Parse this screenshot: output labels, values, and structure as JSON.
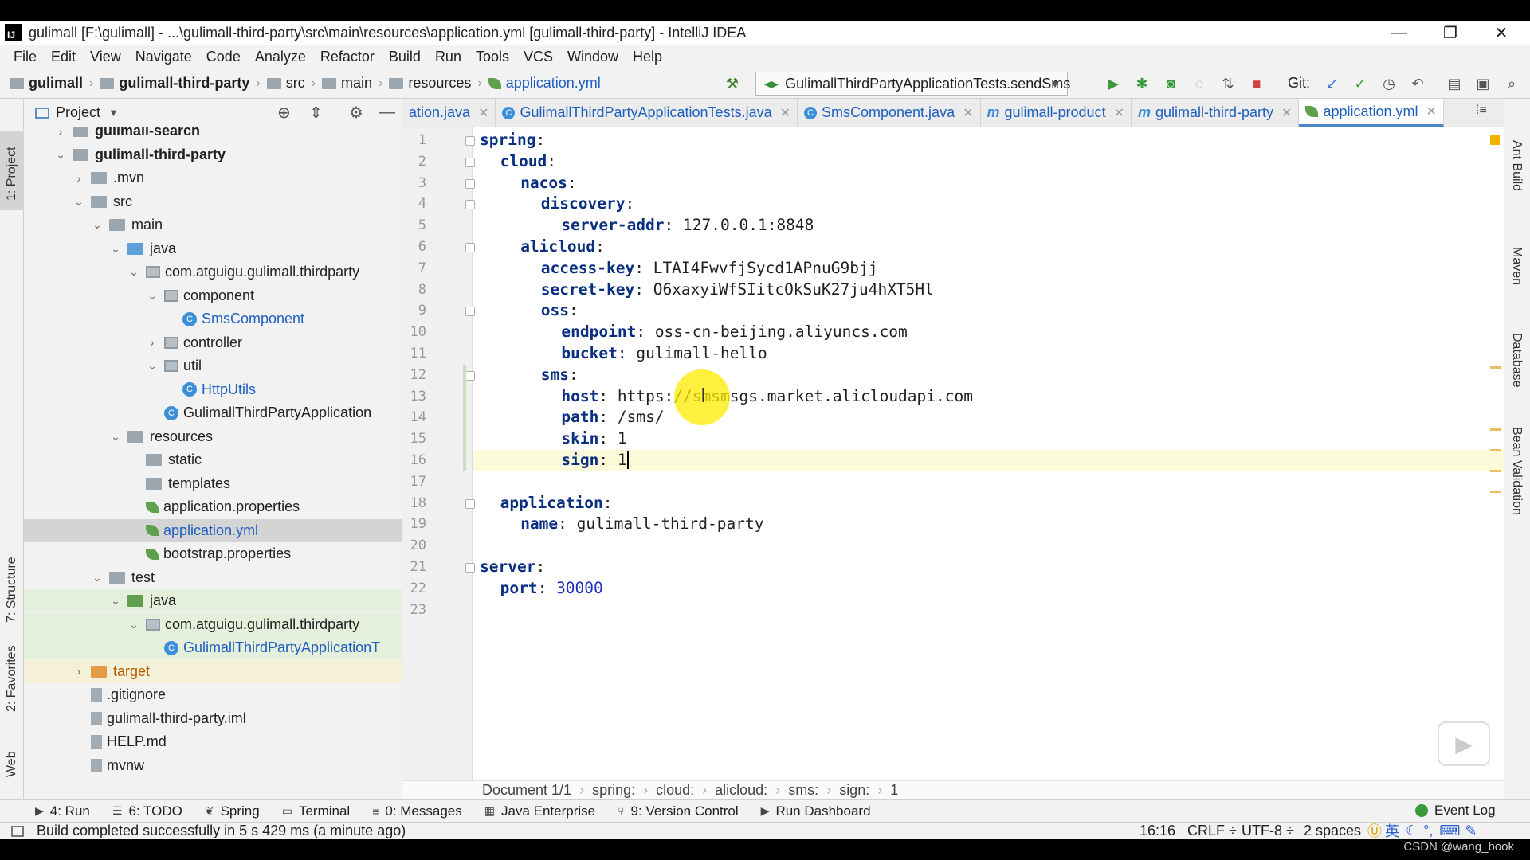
{
  "window": {
    "title": "gulimall [F:\\gulimall] - ...\\gulimall-third-party\\src\\main\\resources\\application.yml [gulimall-third-party] - IntelliJ IDEA",
    "logo_text": "IJ"
  },
  "menu": [
    "File",
    "Edit",
    "View",
    "Navigate",
    "Code",
    "Analyze",
    "Refactor",
    "Build",
    "Run",
    "Tools",
    "VCS",
    "Window",
    "Help"
  ],
  "nav": {
    "crumbs": [
      "gulimall",
      "gulimall-third-party",
      "src",
      "main",
      "resources",
      "application.yml"
    ],
    "run_config": "GulimallThirdPartyApplicationTests.sendSms",
    "git_label": "Git:"
  },
  "tabs": [
    {
      "label": "ation.java",
      "icon": "java-class-icon"
    },
    {
      "label": "GulimallThirdPartyApplicationTests.java",
      "icon": "java-class-icon"
    },
    {
      "label": "SmsComponent.java",
      "icon": "java-class-icon"
    },
    {
      "label": "gulimall-product",
      "icon": "maven-icon"
    },
    {
      "label": "gulimall-third-party",
      "icon": "maven-icon"
    },
    {
      "label": "application.yml",
      "icon": "yaml-icon",
      "active": true
    }
  ],
  "project_panel": {
    "title": "Project",
    "tree": [
      {
        "label": "gulimall-search",
        "depth": 1,
        "arrow": "right",
        "icon": "module",
        "bold": true
      },
      {
        "label": "gulimall-third-party",
        "depth": 1,
        "arrow": "down",
        "icon": "module",
        "bold": true
      },
      {
        "label": ".mvn",
        "depth": 2,
        "arrow": "right",
        "icon": "folder"
      },
      {
        "label": "src",
        "depth": 2,
        "arrow": "down",
        "icon": "folder"
      },
      {
        "label": "main",
        "depth": 3,
        "arrow": "down",
        "icon": "folder"
      },
      {
        "label": "java",
        "depth": 4,
        "arrow": "down",
        "icon": "folder-blue"
      },
      {
        "label": "com.atguigu.gulimall.thirdparty",
        "depth": 5,
        "arrow": "down",
        "icon": "package"
      },
      {
        "label": "component",
        "depth": 6,
        "arrow": "down",
        "icon": "package"
      },
      {
        "label": "SmsComponent",
        "depth": 7,
        "arrow": "",
        "icon": "class",
        "color": "blue"
      },
      {
        "label": "controller",
        "depth": 6,
        "arrow": "right",
        "icon": "package"
      },
      {
        "label": "util",
        "depth": 6,
        "arrow": "down",
        "icon": "package"
      },
      {
        "label": "HttpUtils",
        "depth": 7,
        "arrow": "",
        "icon": "class",
        "color": "blue"
      },
      {
        "label": "GulimallThirdPartyApplication",
        "depth": 6,
        "arrow": "",
        "icon": "class"
      },
      {
        "label": "resources",
        "depth": 4,
        "arrow": "down",
        "icon": "folder"
      },
      {
        "label": "static",
        "depth": 5,
        "arrow": "",
        "icon": "folder"
      },
      {
        "label": "templates",
        "depth": 5,
        "arrow": "",
        "icon": "folder"
      },
      {
        "label": "application.properties",
        "depth": 5,
        "arrow": "",
        "icon": "leaf"
      },
      {
        "label": "application.yml",
        "depth": 5,
        "arrow": "",
        "icon": "leaf",
        "color": "blue",
        "selected": true
      },
      {
        "label": "bootstrap.properties",
        "depth": 5,
        "arrow": "",
        "icon": "leaf"
      },
      {
        "label": "test",
        "depth": 3,
        "arrow": "down",
        "icon": "folder"
      },
      {
        "label": "java",
        "depth": 4,
        "arrow": "down",
        "icon": "folder-green",
        "test": true
      },
      {
        "label": "com.atguigu.gulimall.thirdparty",
        "depth": 5,
        "arrow": "down",
        "icon": "package",
        "test": true
      },
      {
        "label": "GulimallThirdPartyApplicationT",
        "depth": 6,
        "arrow": "",
        "icon": "class",
        "color": "blue",
        "test": true
      },
      {
        "label": "target",
        "depth": 2,
        "arrow": "right",
        "icon": "folder-orange",
        "target": true
      },
      {
        "label": ".gitignore",
        "depth": 2,
        "arrow": "",
        "icon": "file"
      },
      {
        "label": "gulimall-third-party.iml",
        "depth": 2,
        "arrow": "",
        "icon": "file"
      },
      {
        "label": "HELP.md",
        "depth": 2,
        "arrow": "",
        "icon": "file"
      },
      {
        "label": "mvnw",
        "depth": 2,
        "arrow": "",
        "icon": "file"
      }
    ]
  },
  "left_strip": [
    "1: Project",
    "7: Structure",
    "2: Favorites",
    "Web"
  ],
  "right_strip": [
    "Ant Build",
    "Maven",
    "Database",
    "Bean Validation"
  ],
  "editor": {
    "lines": [
      {
        "n": "1",
        "indent": 0,
        "key": "spring",
        "value": ""
      },
      {
        "n": "2",
        "indent": 1,
        "key": "cloud",
        "value": ""
      },
      {
        "n": "3",
        "indent": 2,
        "key": "nacos",
        "value": ""
      },
      {
        "n": "4",
        "indent": 3,
        "key": "discovery",
        "value": ""
      },
      {
        "n": "5",
        "indent": 4,
        "key": "server-addr",
        "value": "127.0.0.1:8848"
      },
      {
        "n": "6",
        "indent": 2,
        "key": "alicloud",
        "value": ""
      },
      {
        "n": "7",
        "indent": 3,
        "key": "access-key",
        "value": "LTAI4FwvfjSycd1APnuG9bjj"
      },
      {
        "n": "8",
        "indent": 3,
        "key": "secret-key",
        "value": "O6xaxyiWfSIitcOkSuK27ju4hXT5Hl"
      },
      {
        "n": "9",
        "indent": 3,
        "key": "oss",
        "value": ""
      },
      {
        "n": "10",
        "indent": 4,
        "key": "endpoint",
        "value": "oss-cn-beijing.aliyuncs.com"
      },
      {
        "n": "11",
        "indent": 4,
        "key": "bucket",
        "value": "gulimall-hello"
      },
      {
        "n": "12",
        "indent": 3,
        "key": "sms",
        "value": ""
      },
      {
        "n": "13",
        "indent": 4,
        "key": "host",
        "value": "https://smsmsgs.market.alicloudapi.com"
      },
      {
        "n": "14",
        "indent": 4,
        "key": "path",
        "value": "/sms/"
      },
      {
        "n": "15",
        "indent": 4,
        "key": "skin",
        "value": "1"
      },
      {
        "n": "16",
        "indent": 4,
        "key": "sign",
        "value": "1",
        "current": true
      },
      {
        "n": "17",
        "indent": 0,
        "key": "",
        "value": ""
      },
      {
        "n": "18",
        "indent": 1,
        "key": "application",
        "value": ""
      },
      {
        "n": "19",
        "indent": 2,
        "key": "name",
        "value": "gulimall-third-party"
      },
      {
        "n": "20",
        "indent": 0,
        "key": "",
        "value": ""
      },
      {
        "n": "21",
        "indent": 0,
        "key": "server",
        "value": ""
      },
      {
        "n": "22",
        "indent": 1,
        "key": "port",
        "value": "30000",
        "numeric": true
      },
      {
        "n": "23",
        "indent": 0,
        "key": "",
        "value": ""
      }
    ],
    "breadcrumb": [
      "Document 1/1",
      "spring:",
      "cloud:",
      "alicloud:",
      "sms:",
      "sign:",
      "1"
    ]
  },
  "tool_windows": [
    {
      "label": "4: Run",
      "icon": "run-icon"
    },
    {
      "label": "6: TODO",
      "icon": "todo-icon"
    },
    {
      "label": "Spring",
      "icon": "spring-icon"
    },
    {
      "label": "Terminal",
      "icon": "terminal-icon"
    },
    {
      "label": "0: Messages",
      "icon": "messages-icon"
    },
    {
      "label": "Java Enterprise",
      "icon": "java-enterprise-icon"
    },
    {
      "label": "9: Version Control",
      "icon": "vcs-icon"
    },
    {
      "label": "Run Dashboard",
      "icon": "run-dashboard-icon"
    }
  ],
  "event_log": "Event Log",
  "status": {
    "message": "Build completed successfully in 5 s 429 ms (a minute ago)",
    "position": "16:16",
    "line_sep": "CRLF ÷",
    "encoding": "UTF-8 ÷",
    "indent": "2 spaces",
    "ime": "英"
  },
  "watermark": "CSDN @wang_book"
}
